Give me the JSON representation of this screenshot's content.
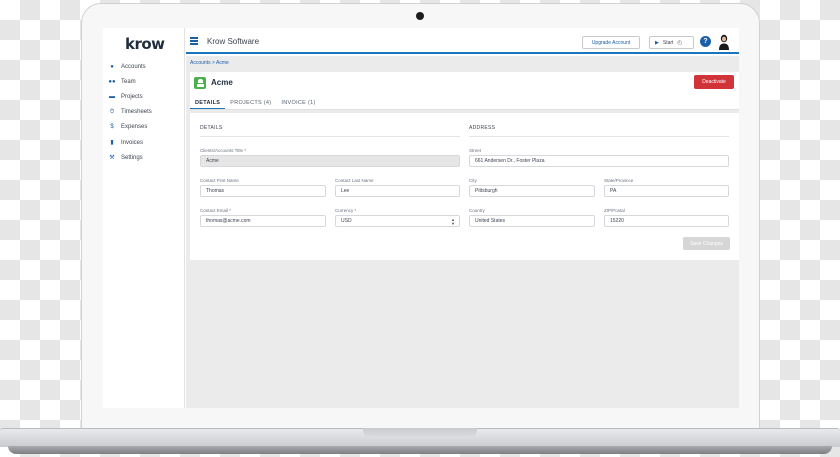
{
  "app": {
    "logo": "krow",
    "title": "Krow Software"
  },
  "sidebar": {
    "items": [
      {
        "label": "Accounts",
        "icon": "person-icon"
      },
      {
        "label": "Team",
        "icon": "team-icon"
      },
      {
        "label": "Projects",
        "icon": "folder-icon"
      },
      {
        "label": "Timesheets",
        "icon": "clock-icon"
      },
      {
        "label": "Expenses",
        "icon": "dollar-icon"
      },
      {
        "label": "Invoices",
        "icon": "document-icon"
      },
      {
        "label": "Settings",
        "icon": "wrench-icon"
      }
    ]
  },
  "topbar": {
    "upgrade_label": "Upgrade Account",
    "start_label": "Start"
  },
  "breadcrumb": "Accounts > Acme",
  "record": {
    "title": "Acme",
    "deactivate_label": "Deactivate",
    "tabs": [
      {
        "label": "DETAILS"
      },
      {
        "label": "PROJECTS (4)"
      },
      {
        "label": "INVOICE (1)"
      }
    ]
  },
  "form": {
    "details_heading": "DETAILS",
    "address_heading": "ADDRESS",
    "client_title_label": "Clients/Accounts Title *",
    "client_title_value": "Acme",
    "first_name_label": "Contact First Name",
    "first_name_value": "Thomas",
    "last_name_label": "Contact Last Name",
    "last_name_value": "Lee",
    "email_label": "Contact Email *",
    "email_value": "thomas@acme.com",
    "currency_label": "Currency *",
    "currency_value": "USD",
    "street_label": "Street",
    "street_value": "661 Andersen Dr., Foster Plaza",
    "city_label": "City",
    "city_value": "Pittsburgh",
    "state_label": "State/Province",
    "state_value": "PA",
    "country_label": "Country",
    "country_value": "United States",
    "zip_label": "ZIP/Postal",
    "zip_value": "15220",
    "save_label": "Save Changes"
  },
  "colors": {
    "brand_blue": "#1b75bc",
    "danger_red": "#d13438",
    "record_icon_green": "#4caf50"
  }
}
